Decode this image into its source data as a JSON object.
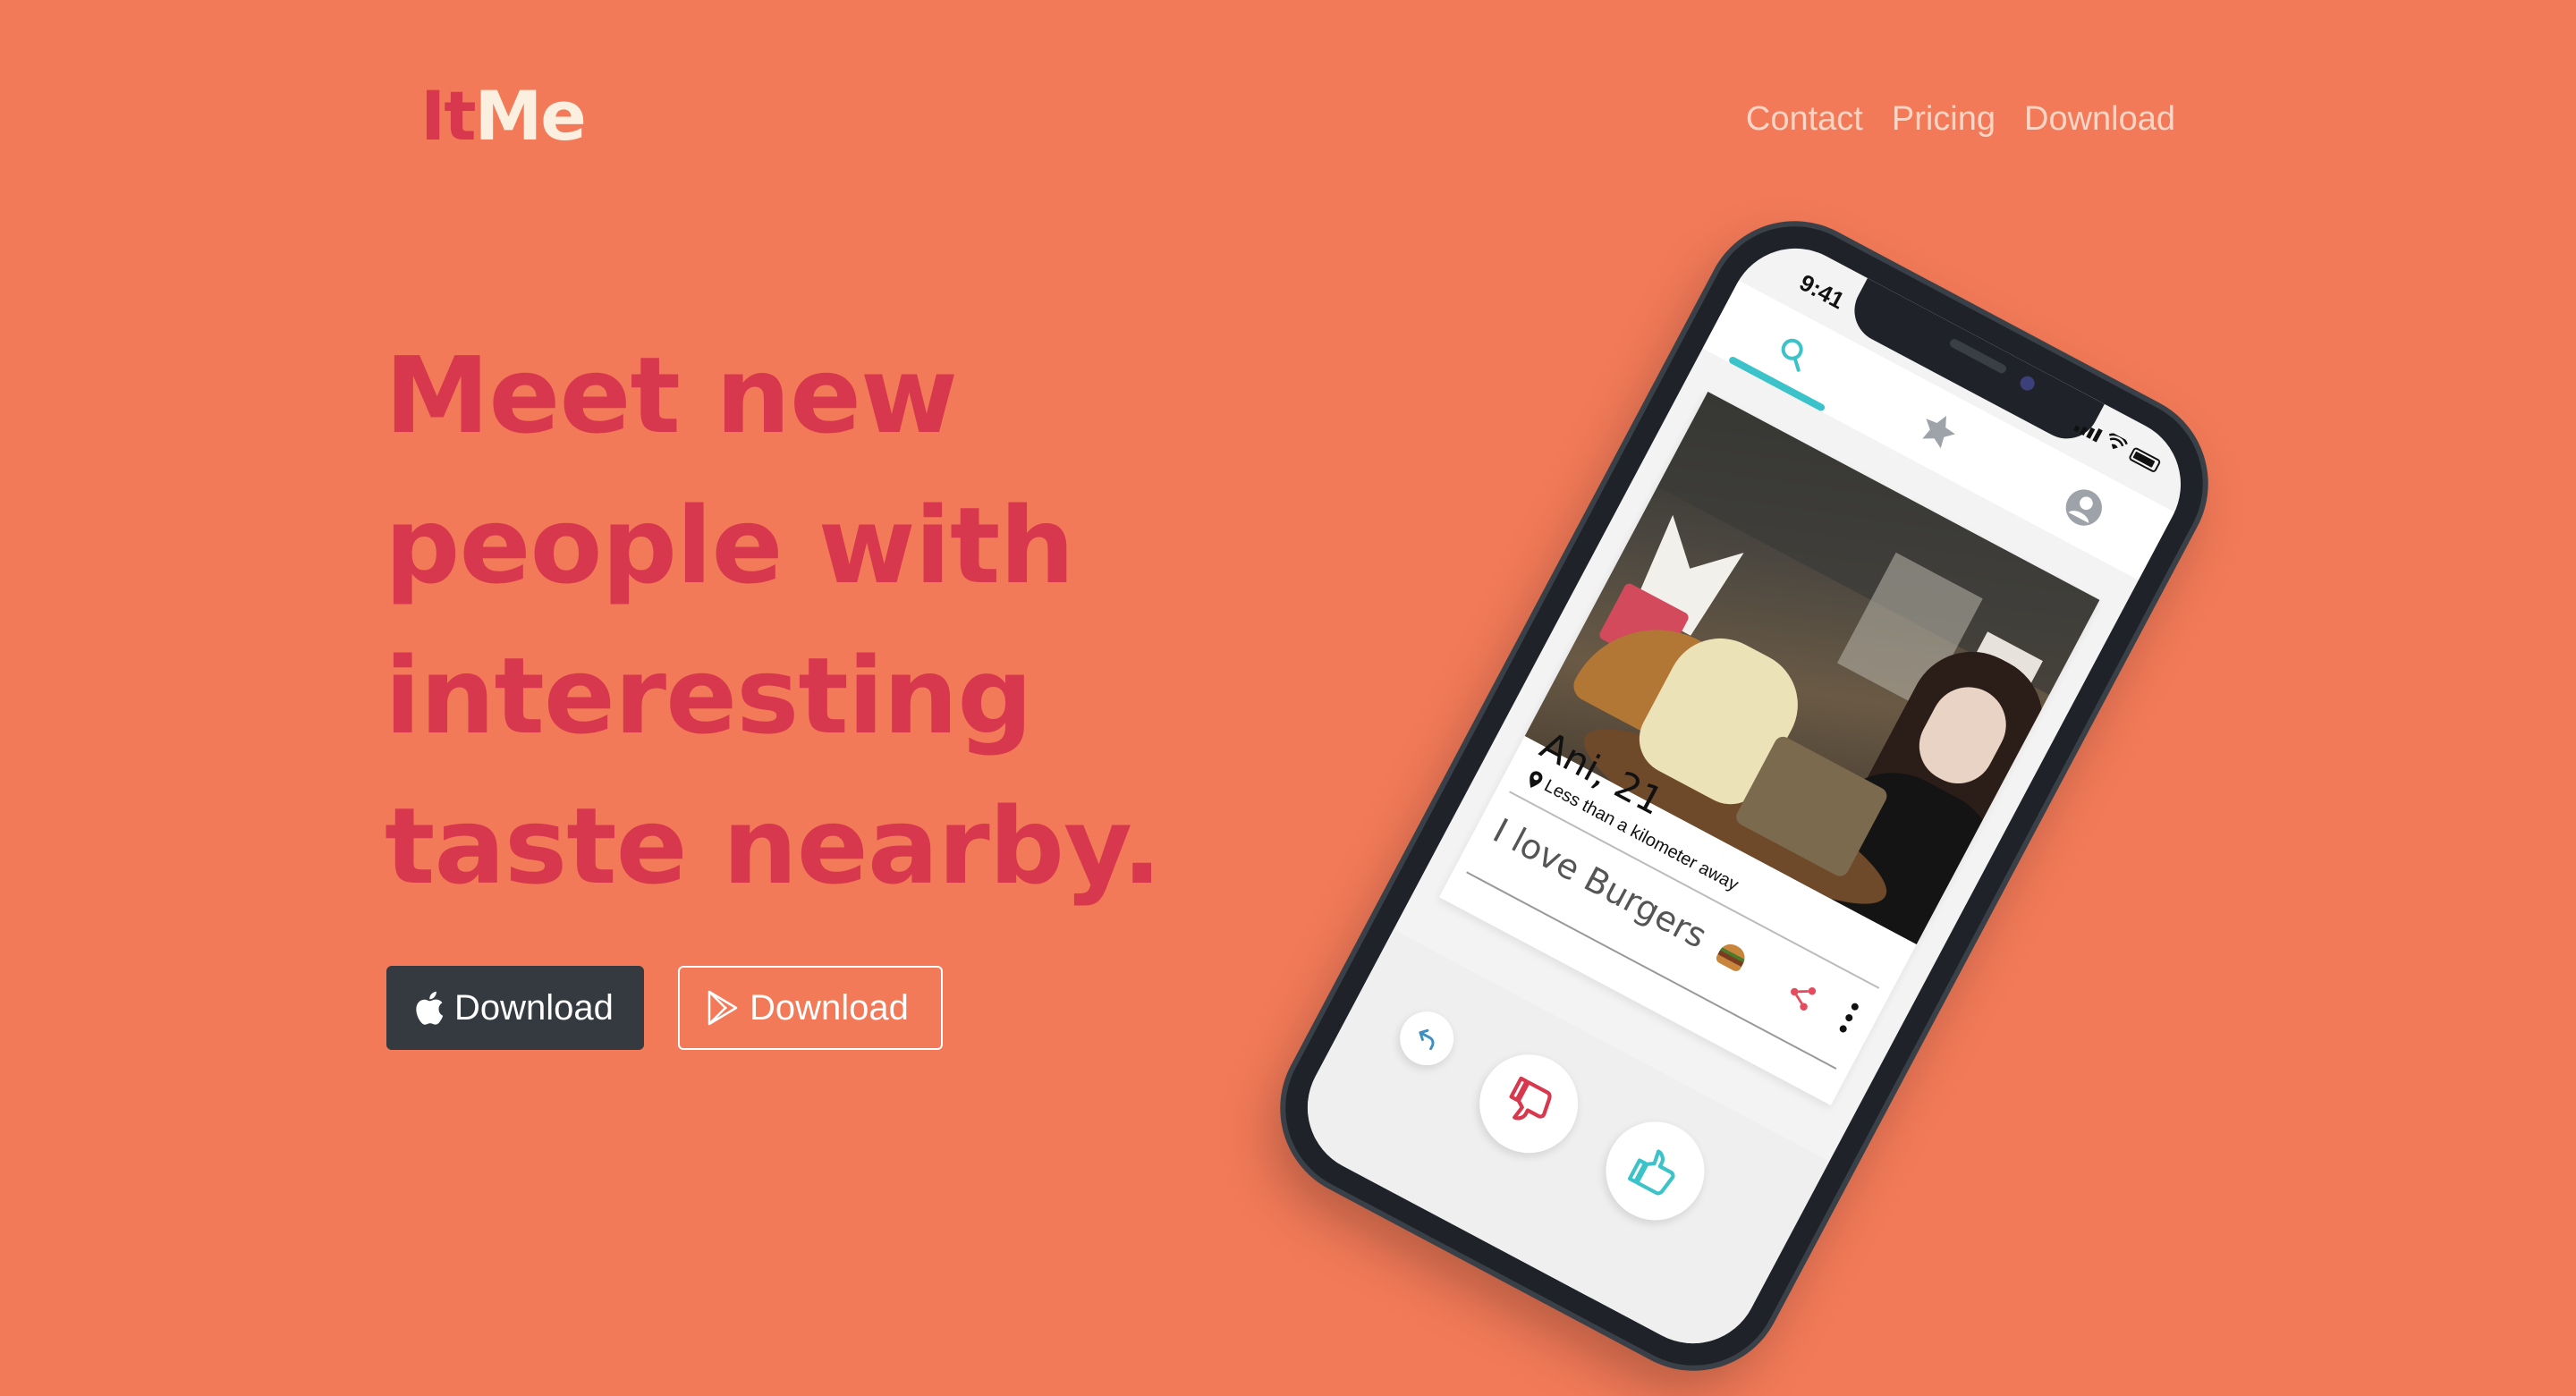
{
  "header": {
    "logo": {
      "part1": "It",
      "part2": "Me"
    },
    "nav": [
      {
        "label": "Contact"
      },
      {
        "label": "Pricing"
      },
      {
        "label": "Download"
      }
    ]
  },
  "hero": {
    "headline_lines": [
      "Meet new",
      "people with",
      "interesting",
      "taste nearby."
    ],
    "buttons": {
      "ios": {
        "label": "Download",
        "icon": "apple-icon"
      },
      "android": {
        "label": "Download",
        "icon": "google-play-icon"
      }
    }
  },
  "phone": {
    "status_time": "9:41",
    "tabs": [
      {
        "icon": "search-icon",
        "active": true
      },
      {
        "icon": "star-icon",
        "active": false
      },
      {
        "icon": "user-icon",
        "active": false
      }
    ],
    "profile": {
      "name_age": "Ani, 21",
      "distance": "Less than a kilometer away",
      "bio": "I love Burgers"
    },
    "actions": [
      "undo-icon",
      "thumbs-down-icon",
      "thumbs-up-icon"
    ]
  },
  "colors": {
    "background": "#F27A58",
    "accent_red": "#D8384E",
    "logo_light": "#FBEFE0",
    "nav_text": "#FBD6C6",
    "dark_button": "#343A40",
    "teal": "#3CC2C9"
  }
}
